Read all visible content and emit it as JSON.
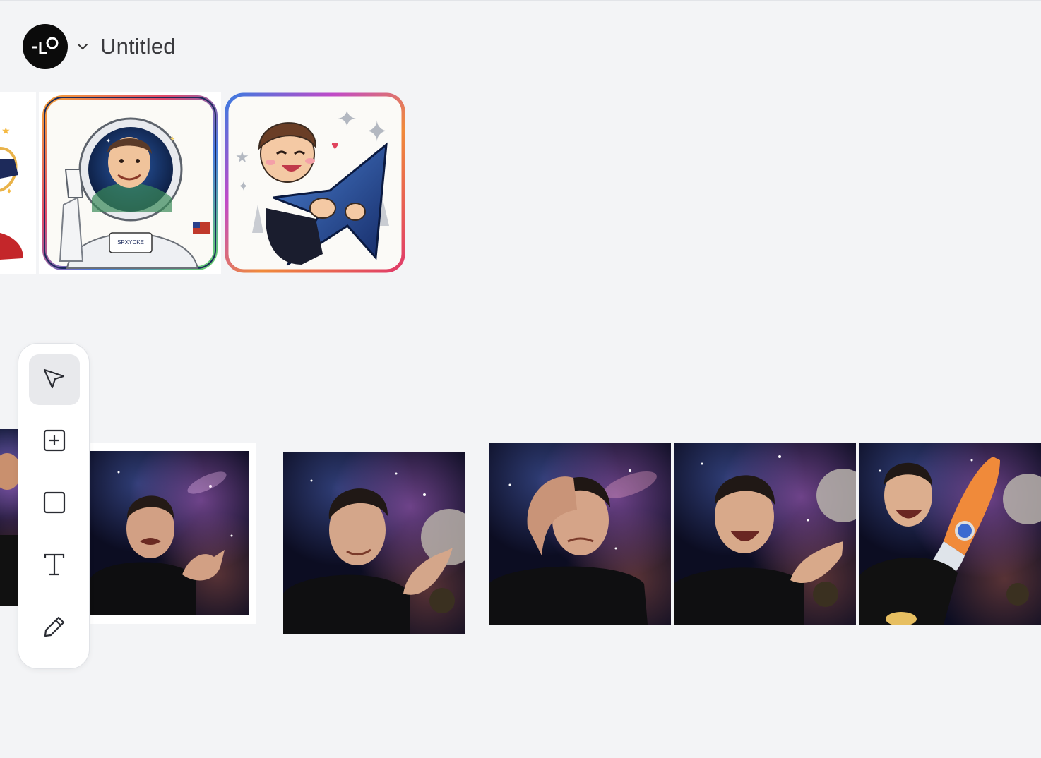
{
  "header": {
    "title": "Untitled",
    "logo_icon": "lo-logo-icon",
    "menu_icon": "chevron-down-icon"
  },
  "sticker_badge_text": "SPXYCKE",
  "toolbar": {
    "tools": [
      {
        "name": "select",
        "icon": "cursor-icon",
        "active": true
      },
      {
        "name": "add",
        "icon": "plus-square-icon",
        "active": false
      },
      {
        "name": "frame",
        "icon": "square-icon",
        "active": false
      },
      {
        "name": "text",
        "icon": "text-icon",
        "active": false
      },
      {
        "name": "draw",
        "icon": "pencil-icon",
        "active": false
      }
    ]
  },
  "colors": {
    "canvas_bg": "#f3f4f6",
    "space_bg": "#0c0d22",
    "active_tool_bg": "#e8e9ec"
  }
}
